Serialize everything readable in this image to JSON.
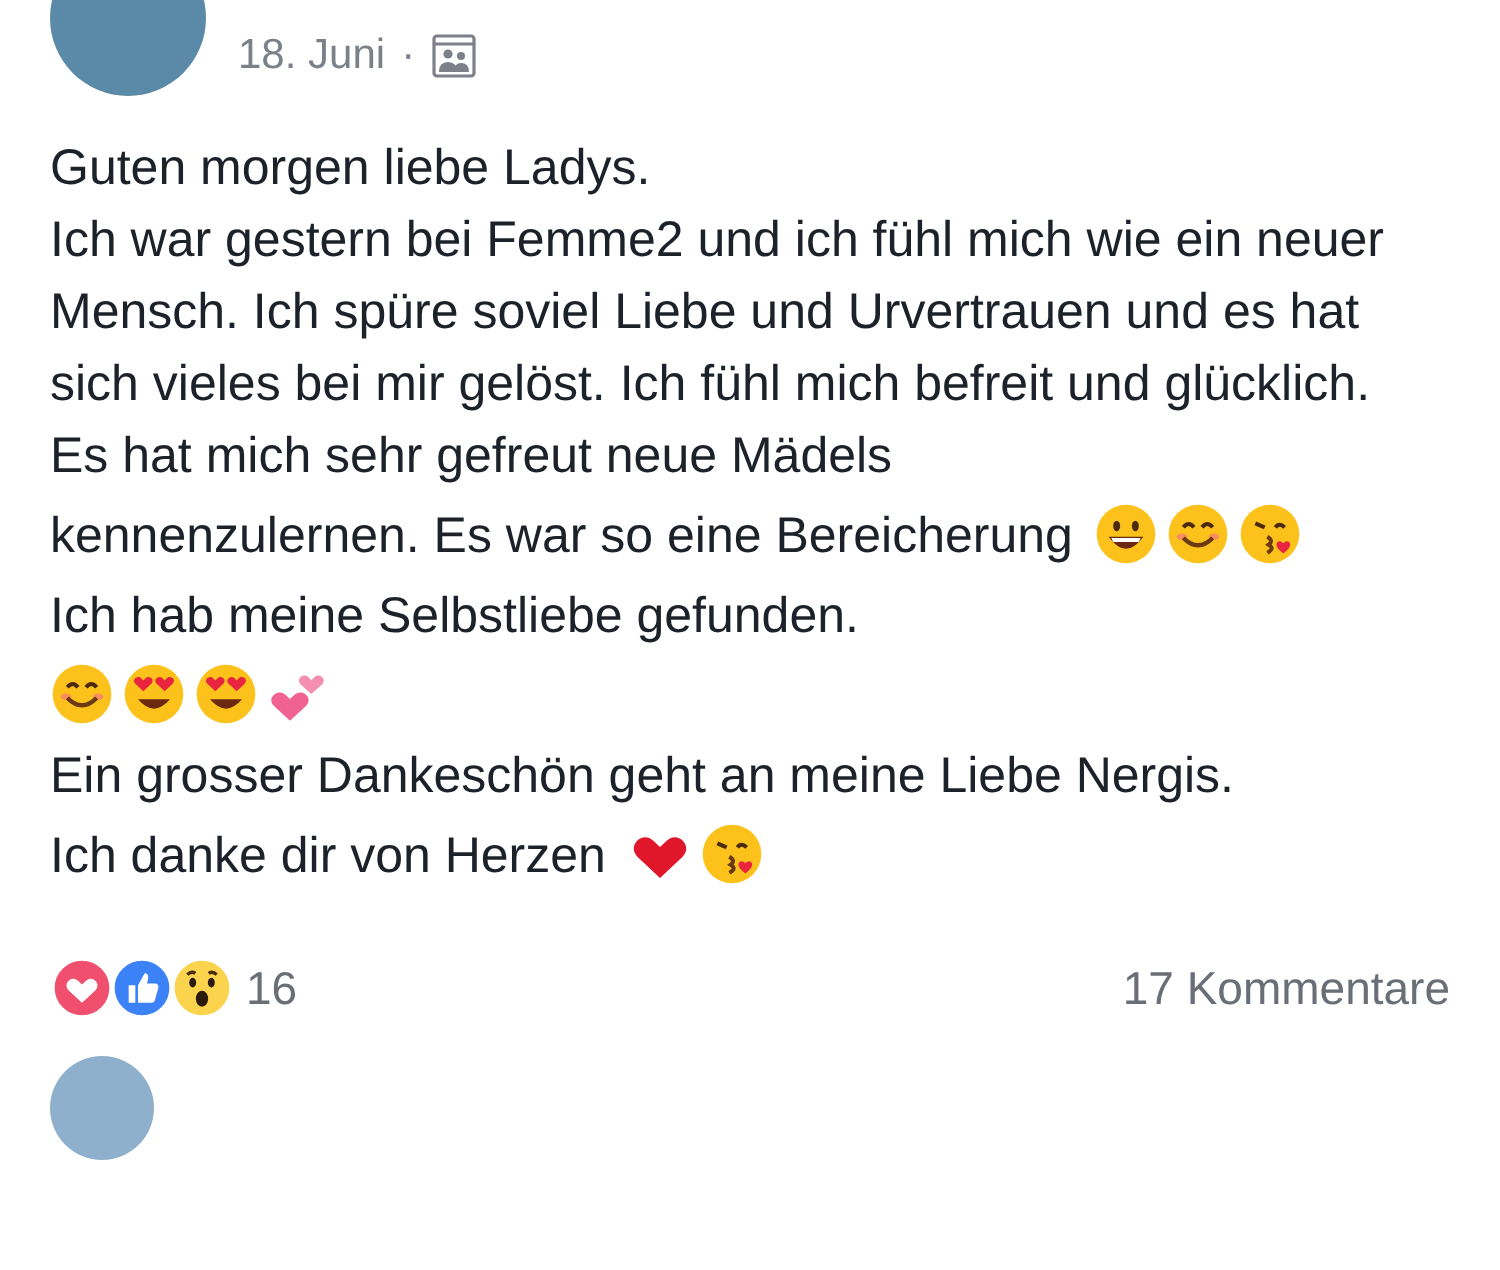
{
  "post": {
    "date": "18. Juni",
    "separator": "·",
    "paragraphs": [
      {
        "text": "Guten morgen liebe Ladys."
      },
      {
        "text": "Ich war gestern bei Femme2 und ich fühl mich wie ein neuer Mensch. Ich spüre soviel Liebe und Urvertrauen und es hat sich vieles bei mir gelöst. Ich fühl mich befreit und glücklich."
      },
      {
        "text": "Es hat mich sehr gefreut neue Mädels"
      },
      {
        "text": "kennenzulernen. Es war so eine Bereicherung",
        "emojis": [
          {
            "kind": "grin"
          },
          {
            "kind": "smile"
          },
          {
            "kind": "kiss"
          }
        ]
      },
      {
        "text": "Ich hab meine Selbstliebe gefunden."
      },
      {
        "emojis": [
          {
            "kind": "smile"
          },
          {
            "kind": "hearteyes"
          },
          {
            "kind": "hearteyes"
          },
          {
            "kind": "twohearts"
          }
        ]
      },
      {
        "text": "Ein grosser Dankeschön geht an meine Liebe Nergis."
      },
      {
        "text": "Ich danke dir von Herzen",
        "emojis": [
          {
            "kind": "redheart"
          },
          {
            "kind": "kiss"
          }
        ]
      }
    ],
    "reactions": [
      {
        "kind": "love"
      },
      {
        "kind": "like"
      },
      {
        "kind": "wow"
      }
    ],
    "reaction_count": "16",
    "comments": "17 Kommentare"
  }
}
